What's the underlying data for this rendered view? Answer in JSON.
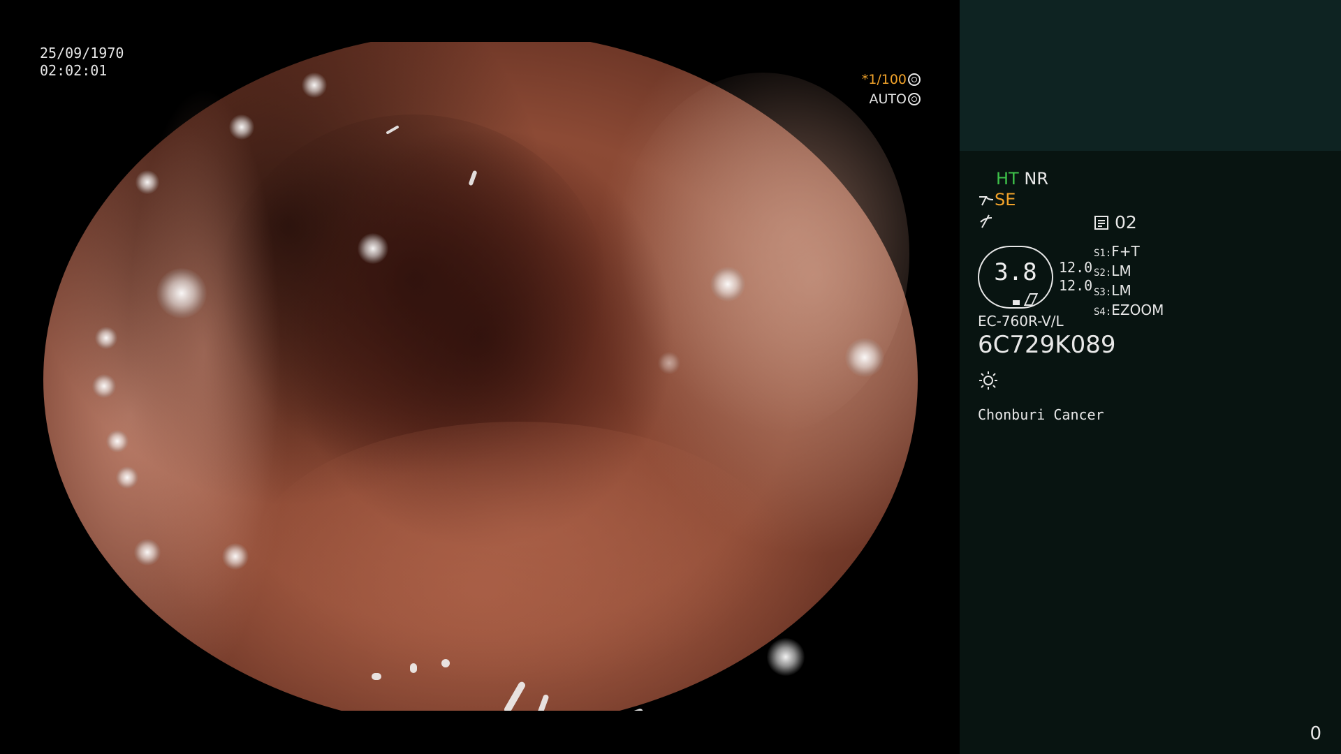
{
  "overlay": {
    "date": "25/09/1970",
    "time": "02:02:01",
    "shutter_speed": "*1/100",
    "iris_mode": "AUTO"
  },
  "panel": {
    "ht_label": "HT",
    "nr_label": "NR",
    "se_label": "SE",
    "memory_slot": "02",
    "zoom_value": "3.8",
    "gain_top": "12.0",
    "gain_bottom": "12.0",
    "switches": [
      {
        "key": "S1:",
        "value": "F+T"
      },
      {
        "key": "S2:",
        "value": "LM"
      },
      {
        "key": "S3:",
        "value": "LM"
      },
      {
        "key": "S4:",
        "value": "EZOOM"
      }
    ],
    "scope_model": "EC-760R-V/L",
    "scope_serial": "6C729K089",
    "light_icon": "sun-icon",
    "institution": "Chonburi Cancer",
    "frame_counter": "0"
  },
  "colors": {
    "background": "#000000",
    "panel_bg": "#081411",
    "panel_top_bg": "#0e2322",
    "highlight_green": "#3ec24a",
    "highlight_orange": "#f2a32a",
    "text": "#e8e8e8"
  }
}
